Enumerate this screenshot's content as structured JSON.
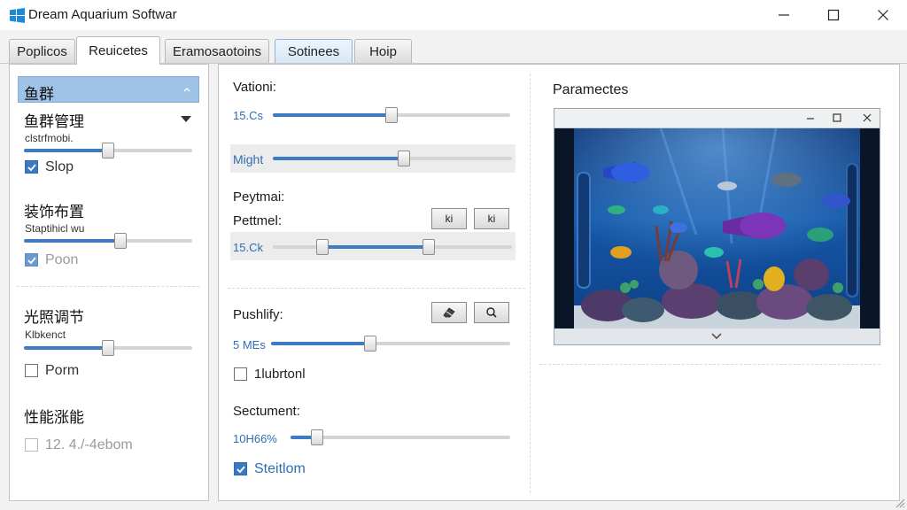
{
  "window": {
    "title": "Dream Aquarium Softwar",
    "icon": "windows-logo-icon",
    "controls": [
      "minimize-icon",
      "maximize-icon",
      "close-icon"
    ]
  },
  "tabs": [
    {
      "label": "Poplicos",
      "active": false
    },
    {
      "label": "Reuicetes",
      "active": true
    },
    {
      "label": "Eramosaotoins",
      "active": false
    },
    {
      "label": "Sotinees",
      "active": false
    },
    {
      "label": "Hoip",
      "active": false
    }
  ],
  "sidebar": {
    "header": "鱼群",
    "sections": [
      {
        "title": "鱼群管理",
        "sub": "clstrfmobi.",
        "slider": 0.5,
        "checkbox_label": "Slop",
        "checked": true,
        "dim": false
      },
      {
        "title": "装饰布置",
        "sub": "Staptihicl wu",
        "slider": 0.58,
        "checkbox_label": "Poon",
        "checked": true,
        "dim": true
      },
      {
        "title": "光照调节",
        "sub": "Klbkenct",
        "slider": 0.5,
        "checkbox_label": "Porm",
        "checked": false,
        "dim": false
      },
      {
        "title": "性能涨能",
        "checkbox_label": "12. 4./-4ebom",
        "checked": false,
        "dim": true
      }
    ]
  },
  "settings": {
    "vationi": {
      "label": "Vationi:",
      "value": "15.Cs",
      "level": 0.5
    },
    "might": {
      "label": "Might",
      "level": 0.55
    },
    "peytmai": {
      "label": "Peytmai:"
    },
    "pettmel": {
      "label": "Pettmel:",
      "value": "15.Ck",
      "low": 0.19,
      "high": 0.66,
      "btn1": "ki",
      "btn2": "ki"
    },
    "pushify": {
      "label": "Pushlify:",
      "value": "5 MEs",
      "level": 0.41
    },
    "lubrtonl": {
      "label": "1lubrtonl",
      "checked": false
    },
    "sectument": {
      "label": "Sectument:",
      "value": "10H66%",
      "level": 0.1
    },
    "steitlom": {
      "label": "Steitlom",
      "checked": true
    }
  },
  "preview": {
    "title": "Paramectes"
  },
  "colors": {
    "accent": "#3d7cc4",
    "header_bg": "#9fc3e7",
    "value_text": "#2f6db5"
  }
}
